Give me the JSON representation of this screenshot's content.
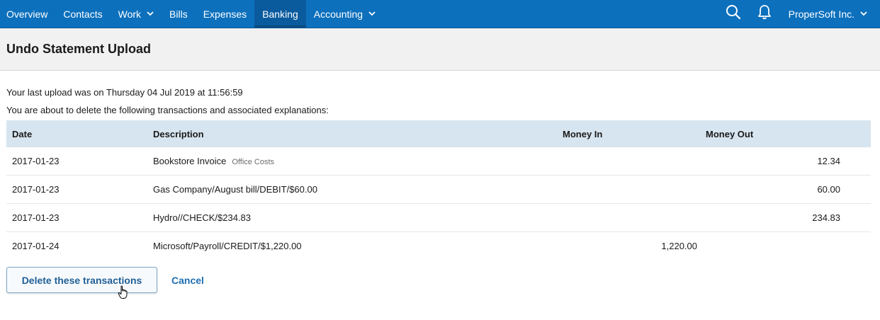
{
  "nav": {
    "items": [
      {
        "label": "Overview",
        "dropdown": false,
        "active": false
      },
      {
        "label": "Contacts",
        "dropdown": false,
        "active": false
      },
      {
        "label": "Work",
        "dropdown": true,
        "active": false
      },
      {
        "label": "Bills",
        "dropdown": false,
        "active": false
      },
      {
        "label": "Expenses",
        "dropdown": false,
        "active": false
      },
      {
        "label": "Banking",
        "dropdown": false,
        "active": true
      },
      {
        "label": "Accounting",
        "dropdown": true,
        "active": false
      }
    ],
    "company": "ProperSoft Inc.",
    "icons": [
      "search-icon",
      "bell-icon",
      "chevron-down-icon"
    ],
    "colors": {
      "bar": "#0c70bd",
      "active": "#0a5a9e"
    }
  },
  "page": {
    "title": "Undo Statement Upload",
    "last_upload": "Your last upload was on Thursday 04 Jul 2019 at 11:56:59",
    "warning": "You are about to delete the following transactions and associated explanations:"
  },
  "table": {
    "headers": {
      "date": "Date",
      "description": "Description",
      "money_in": "Money In",
      "money_out": "Money Out"
    },
    "rows": [
      {
        "date": "2017-01-23",
        "description": "Bookstore Invoice",
        "category": "Office Costs",
        "money_in": "",
        "money_out": "12.34",
        "unexplained": false
      },
      {
        "date": "2017-01-23",
        "description": "Gas Company/August bill/DEBIT/$60.00",
        "category": "",
        "money_in": "",
        "money_out": "60.00",
        "unexplained": true
      },
      {
        "date": "2017-01-23",
        "description": "Hydro//CHECK/$234.83",
        "category": "",
        "money_in": "",
        "money_out": "234.83",
        "unexplained": true
      },
      {
        "date": "2017-01-24",
        "description": "Microsoft/Payroll/CREDIT/$1,220.00",
        "category": "",
        "money_in": "1,220.00",
        "money_out": "",
        "unexplained": true
      }
    ],
    "colors": {
      "header_bg": "#d7e5f0",
      "unexplained_text": "#c8102e"
    }
  },
  "actions": {
    "delete_label": "Delete these transactions",
    "cancel_label": "Cancel"
  }
}
